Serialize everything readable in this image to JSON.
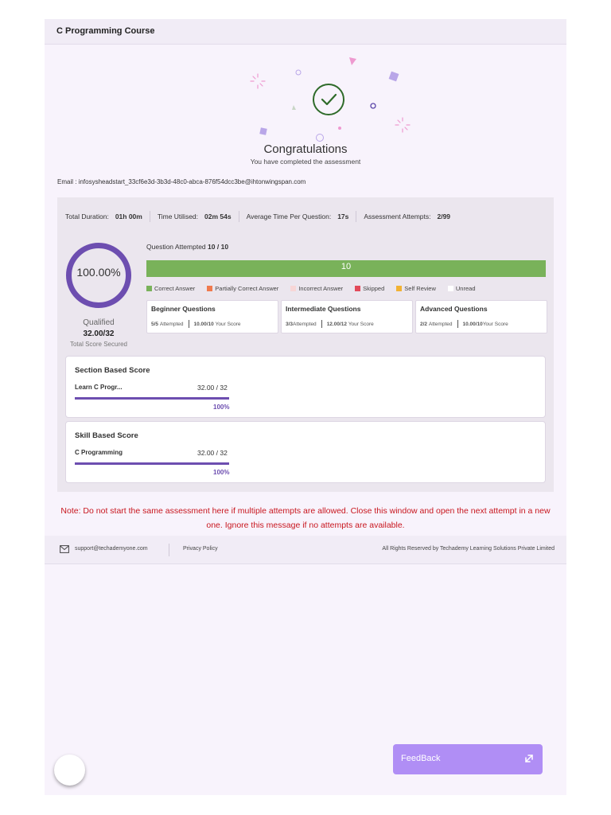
{
  "header": {
    "title": "C Programming Course"
  },
  "hero": {
    "title": "Congratulations",
    "subtitle": "You have completed the assessment"
  },
  "email": {
    "text": "Email : infosysheadstart_33cf6e3d-3b3d-48c0-abca-876f54dcc3be@ihtonwingspan.com"
  },
  "stats": [
    {
      "label": "Total Duration:",
      "value": "01h 00m"
    },
    {
      "label": "Time Utilised:",
      "value": "02m 54s"
    },
    {
      "label": "Average Time Per Question:",
      "value": "17s"
    },
    {
      "label": "Assessment Attempts:",
      "value": "2/99"
    }
  ],
  "score": {
    "percent_text": "100.00%",
    "percent": 100,
    "status": "Qualified",
    "secured": "32.00/32",
    "secured_label": "Total Score Secured"
  },
  "attempted": {
    "label": "Question Attempted",
    "value": "10 / 10",
    "bar_count": "10",
    "fraction": 1.0
  },
  "legend": [
    {
      "label": "Correct Answer",
      "color": "#79b25a"
    },
    {
      "label": "Partially Correct Answer",
      "color": "#f07a4e"
    },
    {
      "label": "Incorrect Answer",
      "color": "#f7d6d6"
    },
    {
      "label": "Skipped",
      "color": "#e24a5a"
    },
    {
      "label": "Self Review",
      "color": "#f2b233"
    },
    {
      "label": "Unread",
      "color": "#ffffff"
    }
  ],
  "question_cards": [
    {
      "title": "Beginner Questions",
      "attempted": "5/5",
      "attempted_label": "Attempted",
      "score": "10.00/10",
      "score_label": "Your Score"
    },
    {
      "title": "Intermediate Questions",
      "attempted": "3/3",
      "attempted_label": "Attempted",
      "score": "12.00/12",
      "score_label": "Your Score"
    },
    {
      "title": "Advanced Questions",
      "attempted": "2/2",
      "attempted_label": "Attempted",
      "score": "10.00/10",
      "score_label": "Your Score"
    }
  ],
  "section_score": {
    "title": "Section Based Score",
    "name": "Learn C Progr...",
    "value": "32.00 / 32",
    "percent_text": "100%",
    "fraction": 1.0
  },
  "skill_score": {
    "title": "Skill Based Score",
    "name": "C Programming",
    "value": "32.00 / 32",
    "percent_text": "100%",
    "fraction": 1.0
  },
  "note": "Note: Do not start the same assessment here if multiple attempts are allowed. Close this window and open the next attempt in a new one. Ignore this message if no attempts are available.",
  "footer": {
    "support_email": "support@techademyone.com",
    "privacy": "Privacy Policy",
    "rights": "All Rights Reserved by Techademy Learning Solutions Private Limited"
  },
  "feedback": {
    "label": "FeedBack"
  },
  "colors": {
    "accent": "#6d4eb0",
    "success": "#79b25a",
    "note": "#c8161e",
    "feedback": "#b08ef5"
  }
}
